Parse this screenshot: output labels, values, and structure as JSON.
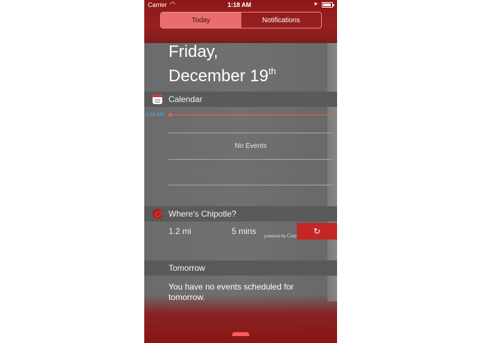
{
  "status_bar": {
    "carrier": "Carrier",
    "time": "1:18 AM",
    "wifi_icon": "wifi-icon",
    "location_icon": "location-arrow-icon",
    "battery_icon": "battery-icon"
  },
  "tabs": [
    {
      "label": "Today",
      "active": true
    },
    {
      "label": "Notifications",
      "active": false
    }
  ],
  "date": {
    "weekday": "Friday,",
    "month_day": "December 19",
    "suffix": "th"
  },
  "calendar": {
    "header": "Calendar",
    "icon": "calendar-icon",
    "now_time": "1:18 AM",
    "empty_text": "No Events"
  },
  "chipotle": {
    "header": "Where's Chipotle?",
    "icon": "chipotle-icon",
    "distance": "1.2 mi",
    "duration": "5 mins",
    "powered_by": "powered by",
    "google": "Google",
    "refresh_icon": "refresh-icon",
    "refresh_glyph": "↻"
  },
  "tomorrow": {
    "header": "Tomorrow",
    "text": "You have no events scheduled for tomorrow."
  },
  "colors": {
    "accent_red": "#c42626",
    "tab_active_bg": "#ea6d6d",
    "now_line": "#ff5a4a",
    "time_label": "#59a8f0"
  }
}
